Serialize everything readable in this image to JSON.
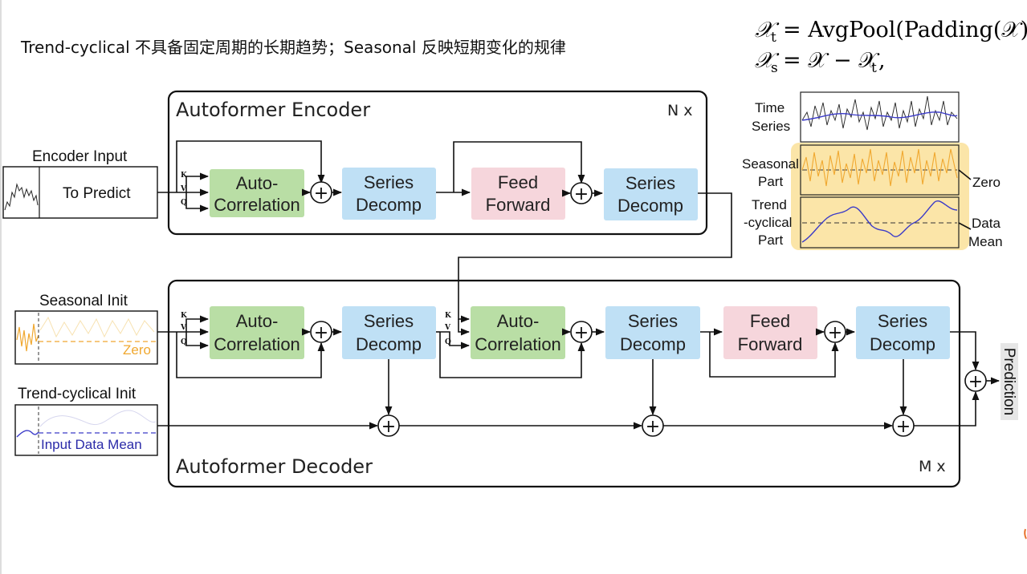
{
  "header": {
    "text": "Trend-cyclical 不具备固定周期的长期趋势；Seasonal 反映短期变化的规律"
  },
  "formula": {
    "line1_lhs": "𝒳",
    "line1_lhs_sub": "t",
    "line1_rhs": "= AvgPool(Padding(𝒳))",
    "line2_lhs": "𝒳",
    "line2_lhs_sub": "s",
    "line2_rhs_a": "= 𝒳 − 𝒳",
    "line2_rhs_sub": "t",
    "line2_rhs_end": ","
  },
  "encoder": {
    "title": "Autoformer Encoder",
    "repeat": "N x",
    "input_label": "Encoder Input",
    "input_text": "To Predict",
    "autocorr_l1": "Auto-",
    "autocorr_l2": "Correlation",
    "decomp1_l1": "Series",
    "decomp1_l2": "Decomp",
    "ff_l1": "Feed",
    "ff_l2": "Forward",
    "decomp2_l1": "Series",
    "decomp2_l2": "Decomp"
  },
  "decoder": {
    "title": "Autoformer Decoder",
    "repeat": "M x",
    "seasonal_label": "Seasonal Init",
    "seasonal_zero": "Zero",
    "trend_label": "Trend-cyclical Init",
    "trend_text": "Input Data Mean",
    "ac1_l1": "Auto-",
    "ac1_l2": "Correlation",
    "sd1_l1": "Series",
    "sd1_l2": "Decomp",
    "ac2_l1": "Auto-",
    "ac2_l2": "Correlation",
    "sd2_l1": "Series",
    "sd2_l2": "Decomp",
    "ff_l1": "Feed",
    "ff_l2": "Forward",
    "sd3_l1": "Series",
    "sd3_l2": "Decomp",
    "prediction": "Prediction"
  },
  "kvq": {
    "k": "K",
    "v": "V",
    "q": "Q"
  },
  "legend": {
    "ts_l1": "Time",
    "ts_l2": "Series",
    "seasonal_l1": "Seasonal",
    "seasonal_l2": "Part",
    "trend_l1": "Trend",
    "trend_l2": "-cyclical",
    "trend_l3": "Part",
    "zero": "Zero",
    "mean_l1": "Data",
    "mean_l2": "Mean"
  },
  "plus_symbol": "+",
  "colors": {
    "autocorrelation": "#b9dea5",
    "series_decomp": "#bfe0f5",
    "feed_forward": "#f6d6dc",
    "seasonal_highlight": "#fbe5a8",
    "seasonal_line": "#f0a830",
    "trend_line": "#3a3ac8",
    "raw_line": "#222222"
  }
}
